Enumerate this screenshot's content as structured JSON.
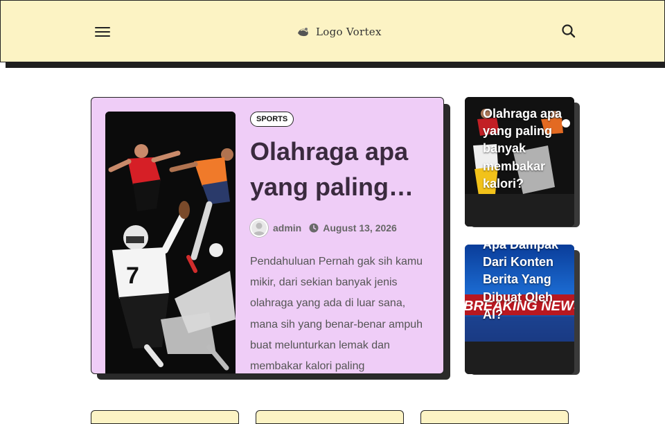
{
  "header": {
    "logo_text": "Logo Vortex",
    "menu_icon": "hamburger-menu-icon",
    "search_icon": "search-icon",
    "background": "#fcf3c4"
  },
  "featured": {
    "category": "SPORTS",
    "title": "Olahraga apa yang paling…",
    "author": "admin",
    "date": "August 13, 2026",
    "excerpt": "Pendahuluan Pernah gak sih kamu mikir, dari sekian banyak jenis olahraga yang ada di luar sana, mana sih yang benar-benar ampuh buat melunturkan lemak dan membakar kalori paling",
    "card_color": "#efcdf7"
  },
  "side_posts": [
    {
      "title": "Olahraga apa yang paling banyak membakar kalori?"
    },
    {
      "title": "Apa Dampak Dari Konten Berita Yang Dibuat Oleh AI?",
      "image_text": "BREAKING NEWS"
    }
  ]
}
